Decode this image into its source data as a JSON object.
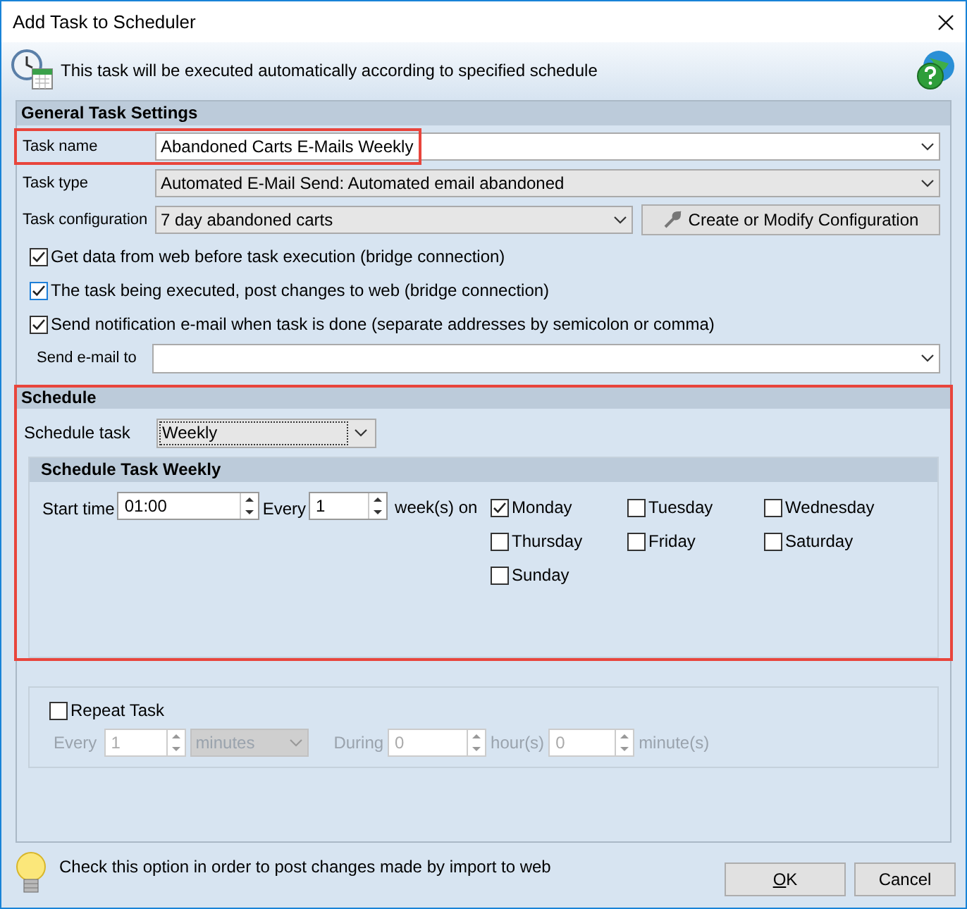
{
  "window": {
    "title": "Add Task to Scheduler"
  },
  "header": {
    "text": "This task will be executed automatically according to specified schedule"
  },
  "general": {
    "title": "General Task Settings",
    "fields": [
      {
        "label": "Task name",
        "value": "Abandoned Carts E-Mails Weekly",
        "kind": "edit",
        "highlighted": true
      },
      {
        "label": "Task type",
        "value": "Automated E-Mail Send: Automated email abandoned",
        "kind": "combo",
        "highlighted": false
      },
      {
        "label": "Task configuration",
        "value": "7 day abandoned carts",
        "kind": "combo-button",
        "button": "Create or Modify Configuration",
        "highlighted": false
      }
    ],
    "options": [
      {
        "label": "Get data from web before task execution (bridge connection)",
        "checked": true,
        "focused": false
      },
      {
        "label": "The task being executed, post changes to web (bridge connection)",
        "checked": true,
        "focused": true
      },
      {
        "label": "Send notification e-mail when task is done (separate addresses by semicolon or comma)",
        "checked": true,
        "focused": false
      }
    ],
    "email": {
      "label": "Send e-mail to"
    }
  },
  "schedule": {
    "title": "Schedule",
    "highlighted": true,
    "label": "Schedule task",
    "value": "Weekly",
    "weekly": {
      "title": "Schedule Task Weekly",
      "start_label": "Start time",
      "start_value": "01:00",
      "every_label": "Every",
      "every_value": "1",
      "unit": "week(s) on",
      "days": [
        {
          "label": "Monday",
          "checked": true
        },
        {
          "label": "Tuesday",
          "checked": false
        },
        {
          "label": "Wednesday",
          "checked": false
        },
        {
          "label": "Thursday",
          "checked": false
        },
        {
          "label": "Friday",
          "checked": false
        },
        {
          "label": "Saturday",
          "checked": false
        },
        {
          "label": "Sunday",
          "checked": false
        }
      ]
    }
  },
  "repeat": {
    "label": "Repeat Task",
    "checked": false,
    "disabled": true,
    "every_label": "Every",
    "every_value": "1",
    "unit": "minutes",
    "during_label": "During",
    "hours_value": "0",
    "hours_unit": "hour(s)",
    "minutes_value": "0",
    "minutes_unit": "minute(s)"
  },
  "footer": {
    "hint": "Check this option in order to post changes made by import to web",
    "buttons": [
      "OK",
      "Cancel"
    ]
  }
}
